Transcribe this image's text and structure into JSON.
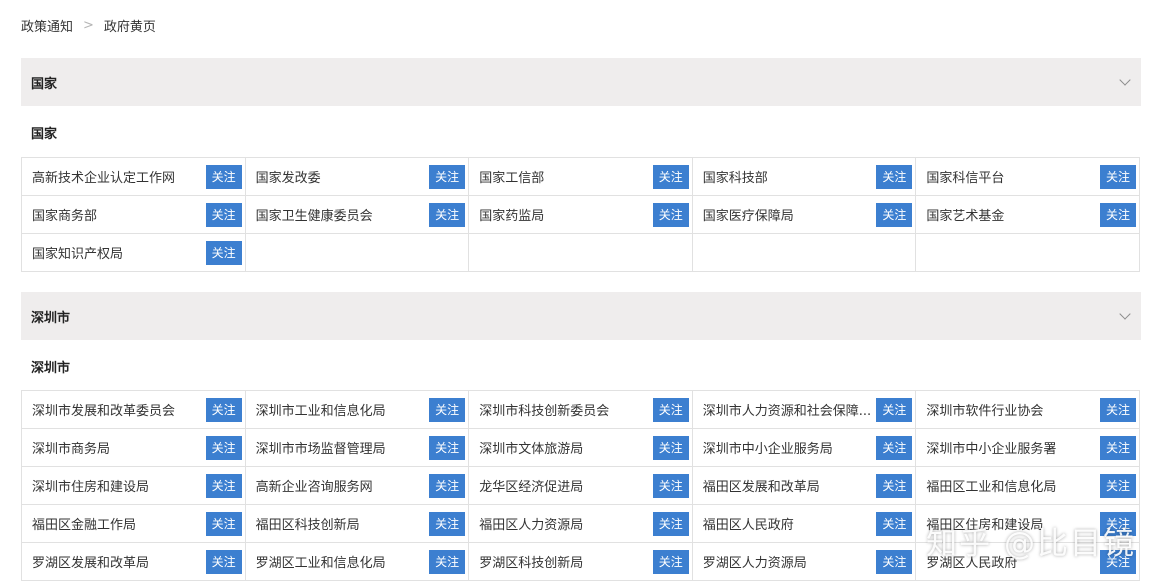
{
  "breadcrumb": {
    "items": [
      "政策通知",
      "政府黄页"
    ],
    "separator": ">"
  },
  "follow_label": "关注",
  "colors": {
    "accent": "#3c7fd0",
    "section_header_bg": "#efeded",
    "border": "#e1e1e1"
  },
  "sections": [
    {
      "header": "国家",
      "subtitle": "国家",
      "items": [
        "高新技术企业认定工作网",
        "国家发改委",
        "国家工信部",
        "国家科技部",
        "国家科信平台",
        "国家商务部",
        "国家卫生健康委员会",
        "国家药监局",
        "国家医疗保障局",
        "国家艺术基金",
        "国家知识产权局"
      ]
    },
    {
      "header": "深圳市",
      "subtitle": "深圳市",
      "items": [
        "深圳市发展和改革委员会",
        "深圳市工业和信息化局",
        "深圳市科技创新委员会",
        "深圳市人力资源和社会保障...",
        "深圳市软件行业协会",
        "深圳市商务局",
        "深圳市市场监督管理局",
        "深圳市文体旅游局",
        "深圳市中小企业服务局",
        "深圳市中小企业服务署",
        "深圳市住房和建设局",
        "高新企业咨询服务网",
        "龙华区经济促进局",
        "福田区发展和改革局",
        "福田区工业和信息化局",
        "福田区金融工作局",
        "福田区科技创新局",
        "福田区人力资源局",
        "福田区人民政府",
        "福田区住房和建设局",
        "罗湖区发展和改革局",
        "罗湖区工业和信息化局",
        "罗湖区科技创新局",
        "罗湖区人力资源局",
        "罗湖区人民政府"
      ]
    }
  ],
  "watermark": "知乎 @比目镜"
}
